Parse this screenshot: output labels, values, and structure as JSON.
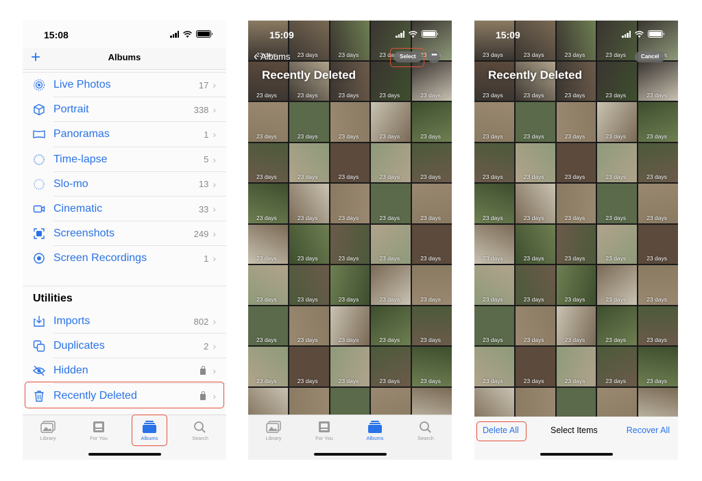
{
  "left": {
    "time": "15:08",
    "nav": {
      "add_label": "+",
      "title": "Albums"
    },
    "media_types": [
      {
        "label": "Live Photos",
        "count": "17",
        "icon": "live-photos-icon"
      },
      {
        "label": "Portrait",
        "count": "338",
        "icon": "cube-icon"
      },
      {
        "label": "Panoramas",
        "count": "1",
        "icon": "panorama-icon"
      },
      {
        "label": "Time-lapse",
        "count": "5",
        "icon": "timelapse-icon"
      },
      {
        "label": "Slo-mo",
        "count": "13",
        "icon": "slomo-icon"
      },
      {
        "label": "Cinematic",
        "count": "33",
        "icon": "cinematic-icon"
      },
      {
        "label": "Screenshots",
        "count": "249",
        "icon": "screenshot-icon"
      },
      {
        "label": "Screen Recordings",
        "count": "1",
        "icon": "screen-recording-icon"
      }
    ],
    "utilities_heading": "Utilities",
    "utilities": [
      {
        "label": "Imports",
        "count": "802",
        "icon": "import-icon"
      },
      {
        "label": "Duplicates",
        "count": "2",
        "icon": "duplicate-icon"
      },
      {
        "label": "Hidden",
        "count": "",
        "icon": "eye-slash-icon",
        "locked": true
      },
      {
        "label": "Recently Deleted",
        "count": "",
        "icon": "trash-icon",
        "locked": true
      }
    ],
    "tabs": [
      {
        "label": "Library",
        "icon": "photo-library-icon",
        "active": false
      },
      {
        "label": "For You",
        "icon": "for-you-icon",
        "active": false
      },
      {
        "label": "Albums",
        "icon": "albums-icon",
        "active": true
      },
      {
        "label": "Search",
        "icon": "search-icon",
        "active": false
      }
    ]
  },
  "middle": {
    "time": "15:09",
    "back_label": "Albums",
    "title": "Recently Deleted",
    "select_label": "Select",
    "more_label": "•••",
    "tabs": [
      {
        "label": "Library",
        "active": false
      },
      {
        "label": "For You",
        "active": false
      },
      {
        "label": "Albums",
        "active": true
      },
      {
        "label": "Search",
        "active": false
      }
    ]
  },
  "right": {
    "time": "15:09",
    "title": "Recently Deleted",
    "cancel_label": "Cancel",
    "delete_all_label": "Delete All",
    "select_items_label": "Select Items",
    "recover_all_label": "Recover All"
  },
  "photo_grid": {
    "days_label": "23 days",
    "palette": [
      "#6b5a4a",
      "#8a7a62",
      "#5c4a3c",
      "#9a8870",
      "#4c5a3a",
      "#3e4e2e",
      "#7a6a55",
      "#b0a38c",
      "#5a6a4a",
      "#8e9a7a",
      "#c9c2b2",
      "#6e7f52"
    ]
  },
  "colors": {
    "accent": "#2a73e8",
    "highlight": "#e4503a"
  }
}
